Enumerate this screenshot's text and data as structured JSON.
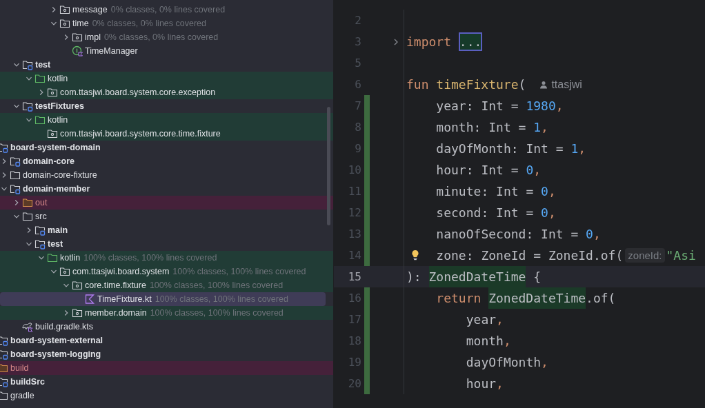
{
  "project_tree": {
    "groups": [
      {
        "items": [
          {
            "label": "message",
            "kind": "package",
            "expanded": false,
            "selected": false,
            "coverage": "0% classes, 0% lines covered"
          },
          {
            "label": "time",
            "kind": "package",
            "expanded": true,
            "selected": false,
            "coverage": "0% classes, 0% lines covered",
            "children": [
              {
                "label": "impl",
                "kind": "package",
                "expanded": false,
                "selected": false,
                "coverage": "0% classes, 0% lines covered"
              },
              {
                "label": "TimeManager",
                "kind": "interface",
                "selected": false
              }
            ]
          }
        ]
      },
      {
        "items": [
          {
            "label": "test",
            "kind": "source_set",
            "expanded": true,
            "selected": false,
            "children": [
              {
                "label": "kotlin",
                "kind": "test_root",
                "expanded": true,
                "selected": false,
                "children": [
                  {
                    "label": "com.ttasjwi.board.system.core.exception",
                    "kind": "package",
                    "expanded": false,
                    "selected": false
                  }
                ]
              }
            ]
          },
          {
            "label": "testFixtures",
            "kind": "source_set",
            "expanded": true,
            "selected": false,
            "children": [
              {
                "label": "kotlin",
                "kind": "test_root",
                "expanded": true,
                "selected": false,
                "children": [
                  {
                    "label": "com.ttasjwi.board.system.core.time.fixture",
                    "kind": "package",
                    "selected": false
                  }
                ]
              }
            ]
          }
        ]
      },
      {
        "items": [
          {
            "label": "board-system-domain",
            "kind": "module",
            "selected": false,
            "children": [
              {
                "label": "domain-core",
                "kind": "module",
                "expanded": false,
                "selected": false
              },
              {
                "label": "domain-core-fixture",
                "kind": "folder",
                "expanded": false,
                "selected": false
              },
              {
                "label": "domain-member",
                "kind": "module",
                "expanded": true,
                "selected": false,
                "children": [
                  {
                    "label": "out",
                    "kind": "excluded",
                    "expanded": false,
                    "selected": false
                  },
                  {
                    "label": "src",
                    "kind": "folder",
                    "expanded": true,
                    "selected": false,
                    "children": [
                      {
                        "label": "main",
                        "kind": "source_set",
                        "expanded": false,
                        "selected": false
                      },
                      {
                        "label": "test",
                        "kind": "source_set",
                        "expanded": true,
                        "selected": false,
                        "children": [
                          {
                            "label": "kotlin",
                            "kind": "test_root",
                            "expanded": true,
                            "selected": false,
                            "coverage": "100% classes, 100% lines covered",
                            "children": [
                              {
                                "label": "com.ttasjwi.board.system",
                                "kind": "package",
                                "expanded": true,
                                "selected": false,
                                "coverage": "100% classes, 100% lines covered",
                                "children": [
                                  {
                                    "label": "core.time.fixture",
                                    "kind": "package",
                                    "expanded": true,
                                    "selected": false,
                                    "coverage": "100% classes, 100% lines covered",
                                    "children": [
                                      {
                                        "label": "TimeFixture.kt",
                                        "kind": "kotlin_file",
                                        "selected": true,
                                        "coverage": "100% classes, 100% lines covered"
                                      }
                                    ]
                                  },
                                  {
                                    "label": "member.domain",
                                    "kind": "package",
                                    "expanded": false,
                                    "selected": false,
                                    "coverage": "100% classes, 100% lines covered"
                                  }
                                ]
                              }
                            ]
                          }
                        ]
                      }
                    ]
                  },
                  {
                    "label": "build.gradle.kts",
                    "kind": "gradle_file",
                    "selected": false
                  }
                ]
              }
            ]
          },
          {
            "label": "board-system-external",
            "kind": "module",
            "selected": false
          },
          {
            "label": "board-system-logging",
            "kind": "module",
            "selected": false
          },
          {
            "label": "build",
            "kind": "excluded",
            "selected": false
          },
          {
            "label": "buildSrc",
            "kind": "module",
            "selected": false
          },
          {
            "label": "gradle",
            "kind": "folder",
            "selected": false
          }
        ]
      }
    ]
  },
  "editor": {
    "lines": [
      {
        "number": "2",
        "changed": false,
        "current": false
      },
      {
        "number": "3",
        "changed": false,
        "current": false,
        "collapsed": true,
        "tokens": [
          {
            "text": "import",
            "kind": "keyword"
          },
          {
            "text": "...",
            "kind": "fold"
          }
        ]
      },
      {
        "number": "5",
        "changed": false,
        "current": false
      },
      {
        "number": "6",
        "changed": false,
        "current": false,
        "tokens": [
          {
            "text": "fun",
            "kind": "keyword"
          },
          {
            "text": "timeFixture",
            "kind": "function"
          },
          {
            "text": "(",
            "kind": "plain"
          },
          {
            "text": "ttasjwi",
            "kind": "author"
          }
        ]
      },
      {
        "number": "7",
        "changed": true,
        "current": false,
        "tokens": [
          {
            "text": "    year: Int = ",
            "kind": "plain"
          },
          {
            "text": "1980",
            "kind": "number"
          },
          {
            "text": ",",
            "kind": "comma"
          }
        ]
      },
      {
        "number": "8",
        "changed": true,
        "current": false,
        "tokens": [
          {
            "text": "    month: Int = ",
            "kind": "plain"
          },
          {
            "text": "1",
            "kind": "number"
          },
          {
            "text": ",",
            "kind": "comma"
          }
        ]
      },
      {
        "number": "9",
        "changed": true,
        "current": false,
        "tokens": [
          {
            "text": "    dayOfMonth: Int = ",
            "kind": "plain"
          },
          {
            "text": "1",
            "kind": "number"
          },
          {
            "text": ",",
            "kind": "comma"
          }
        ]
      },
      {
        "number": "10",
        "changed": true,
        "current": false,
        "tokens": [
          {
            "text": "    hour: Int = ",
            "kind": "plain"
          },
          {
            "text": "0",
            "kind": "number"
          },
          {
            "text": ",",
            "kind": "comma"
          }
        ]
      },
      {
        "number": "11",
        "changed": true,
        "current": false,
        "tokens": [
          {
            "text": "    minute: Int = ",
            "kind": "plain"
          },
          {
            "text": "0",
            "kind": "number"
          },
          {
            "text": ",",
            "kind": "comma"
          }
        ]
      },
      {
        "number": "12",
        "changed": true,
        "current": false,
        "tokens": [
          {
            "text": "    second: Int = ",
            "kind": "plain"
          },
          {
            "text": "0",
            "kind": "number"
          },
          {
            "text": ",",
            "kind": "comma"
          }
        ]
      },
      {
        "number": "13",
        "changed": true,
        "current": false,
        "tokens": [
          {
            "text": "    nanoOfSecond: Int = ",
            "kind": "plain"
          },
          {
            "text": "0",
            "kind": "number"
          },
          {
            "text": ",",
            "kind": "comma"
          }
        ]
      },
      {
        "number": "14",
        "changed": true,
        "current": false,
        "bulb": true,
        "tokens": [
          {
            "text": "    zone: ZoneId = ZoneId.of(",
            "kind": "plain"
          },
          {
            "text": "zoneId:",
            "kind": "hint"
          },
          {
            "text": "\"Asi",
            "kind": "string"
          }
        ]
      },
      {
        "number": "15",
        "changed": false,
        "current": true,
        "tokens": [
          {
            "text": "): ",
            "kind": "plain"
          },
          {
            "text": "ZonedDateTime",
            "kind": "usage"
          },
          {
            "text": " {",
            "kind": "plain"
          }
        ]
      },
      {
        "number": "16",
        "changed": true,
        "current": false,
        "tokens": [
          {
            "text": "    return",
            "kind": "keyword"
          },
          {
            "text": "ZonedDateTime",
            "kind": "usage"
          },
          {
            "text": ".of(",
            "kind": "plain"
          }
        ]
      },
      {
        "number": "17",
        "changed": true,
        "current": false,
        "tokens": [
          {
            "text": "        year",
            "kind": "plain"
          },
          {
            "text": ",",
            "kind": "comma"
          }
        ]
      },
      {
        "number": "18",
        "changed": true,
        "current": false,
        "tokens": [
          {
            "text": "        month",
            "kind": "plain"
          },
          {
            "text": ",",
            "kind": "comma"
          }
        ]
      },
      {
        "number": "19",
        "changed": true,
        "current": false,
        "tokens": [
          {
            "text": "        dayOfMonth",
            "kind": "plain"
          },
          {
            "text": ",",
            "kind": "comma"
          }
        ]
      },
      {
        "number": "20",
        "changed": true,
        "current": false,
        "tokens": [
          {
            "text": "        hour",
            "kind": "plain"
          },
          {
            "text": ",",
            "kind": "comma"
          }
        ]
      }
    ]
  }
}
